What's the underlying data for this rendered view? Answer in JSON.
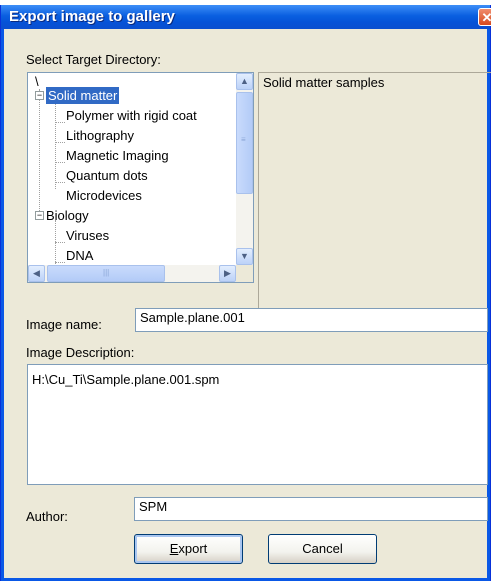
{
  "window": {
    "title": "Export image to gallery",
    "close_glyph": "✕"
  },
  "labels": {
    "select_target": "Select Target Directory:",
    "image_name": "Image name:",
    "image_description": "Image Description:",
    "author": "Author:"
  },
  "tree": {
    "root": "\\",
    "groups": [
      {
        "label": "Solid matter",
        "expanded": true,
        "selected": true,
        "children": [
          "Polymer with rigid coat",
          "Lithography",
          "Magnetic Imaging",
          "Quantum dots",
          "Microdevices"
        ]
      },
      {
        "label": "Biology",
        "expanded": true,
        "selected": false,
        "children": [
          "Viruses",
          "DNA"
        ]
      }
    ]
  },
  "directory_description": "Solid matter samples",
  "fields": {
    "image_name": "Sample.plane.001",
    "image_description": "H:\\Cu_Ti\\Sample.plane.001.spm",
    "author": "SPM"
  },
  "buttons": {
    "export_first": "E",
    "export_rest": "xport",
    "cancel": "Cancel"
  },
  "icons": {
    "expander_open": "−",
    "scroll_up": "▲",
    "scroll_down": "▼",
    "scroll_left": "◀",
    "scroll_right": "▶"
  }
}
